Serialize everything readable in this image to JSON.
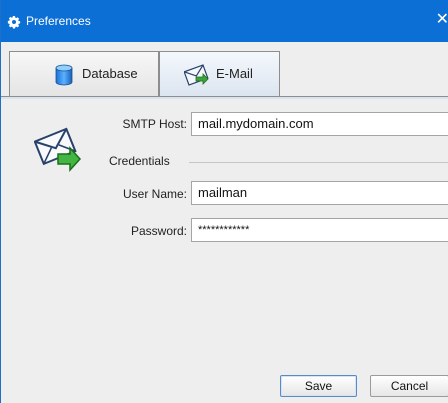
{
  "window": {
    "title": "Preferences",
    "close_glyph": "✕"
  },
  "tabs": [
    {
      "label": "Database",
      "icon": "database-icon",
      "selected": false
    },
    {
      "label": "E-Mail",
      "icon": "email-tab-icon",
      "selected": true
    }
  ],
  "email": {
    "smtp_host_label": "SMTP Host:",
    "smtp_host_value": "mail.mydomain.com",
    "credentials_label": "Credentials",
    "user_name_label": "User Name:",
    "user_name_value": "mailman",
    "password_label": "Password:",
    "password_value": "************",
    "icon": "mail-send-icon"
  },
  "buttons": {
    "save_label": "Save",
    "cancel_label": "Cancel"
  },
  "colors": {
    "titlebar": "#0c6fd6",
    "accent_green": "#2e9e2e"
  }
}
